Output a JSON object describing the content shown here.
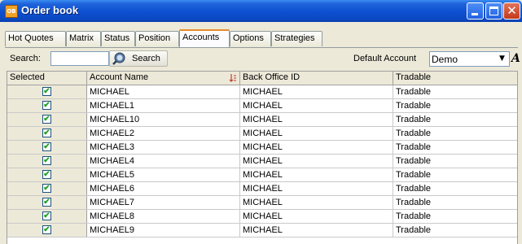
{
  "window": {
    "title": "Order book",
    "app_icon_text": "OB"
  },
  "tabs": [
    {
      "label": "Hot Quotes",
      "active": false
    },
    {
      "label": "Matrix",
      "active": false
    },
    {
      "label": "Status",
      "active": false
    },
    {
      "label": "Position",
      "active": false
    },
    {
      "label": "Accounts",
      "active": true
    },
    {
      "label": "Options",
      "active": false
    },
    {
      "label": "Strategies",
      "active": false
    }
  ],
  "toolbar": {
    "search_label": "Search:",
    "search_value": "",
    "search_button_label": "Search",
    "default_account_label": "Default Account",
    "default_account_value": "Demo",
    "font_button_icon": "A"
  },
  "table": {
    "columns": [
      "Selected",
      "Account Name",
      "Back Office ID",
      "Tradable"
    ],
    "rows": [
      {
        "selected": true,
        "account": "MICHAEL",
        "back_office": "MICHAEL",
        "tradable": "Tradable"
      },
      {
        "selected": true,
        "account": "MICHAEL1",
        "back_office": "MICHAEL",
        "tradable": "Tradable"
      },
      {
        "selected": true,
        "account": "MICHAEL10",
        "back_office": "MICHAEL",
        "tradable": "Tradable"
      },
      {
        "selected": true,
        "account": "MICHAEL2",
        "back_office": "MICHAEL",
        "tradable": "Tradable"
      },
      {
        "selected": true,
        "account": "MICHAEL3",
        "back_office": "MICHAEL",
        "tradable": "Tradable"
      },
      {
        "selected": true,
        "account": "MICHAEL4",
        "back_office": "MICHAEL",
        "tradable": "Tradable"
      },
      {
        "selected": true,
        "account": "MICHAEL5",
        "back_office": "MICHAEL",
        "tradable": "Tradable"
      },
      {
        "selected": true,
        "account": "MICHAEL6",
        "back_office": "MICHAEL",
        "tradable": "Tradable"
      },
      {
        "selected": true,
        "account": "MICHAEL7",
        "back_office": "MICHAEL",
        "tradable": "Tradable"
      },
      {
        "selected": true,
        "account": "MICHAEL8",
        "back_office": "MICHAEL",
        "tradable": "Tradable"
      },
      {
        "selected": true,
        "account": "MICHAEL9",
        "back_office": "MICHAEL",
        "tradable": "Tradable"
      }
    ]
  },
  "colors": {
    "title_bar": "#0d4fd0",
    "active_tab_accent": "#e68b2c",
    "check_mark": "#21a121",
    "close_button": "#c2391a"
  }
}
